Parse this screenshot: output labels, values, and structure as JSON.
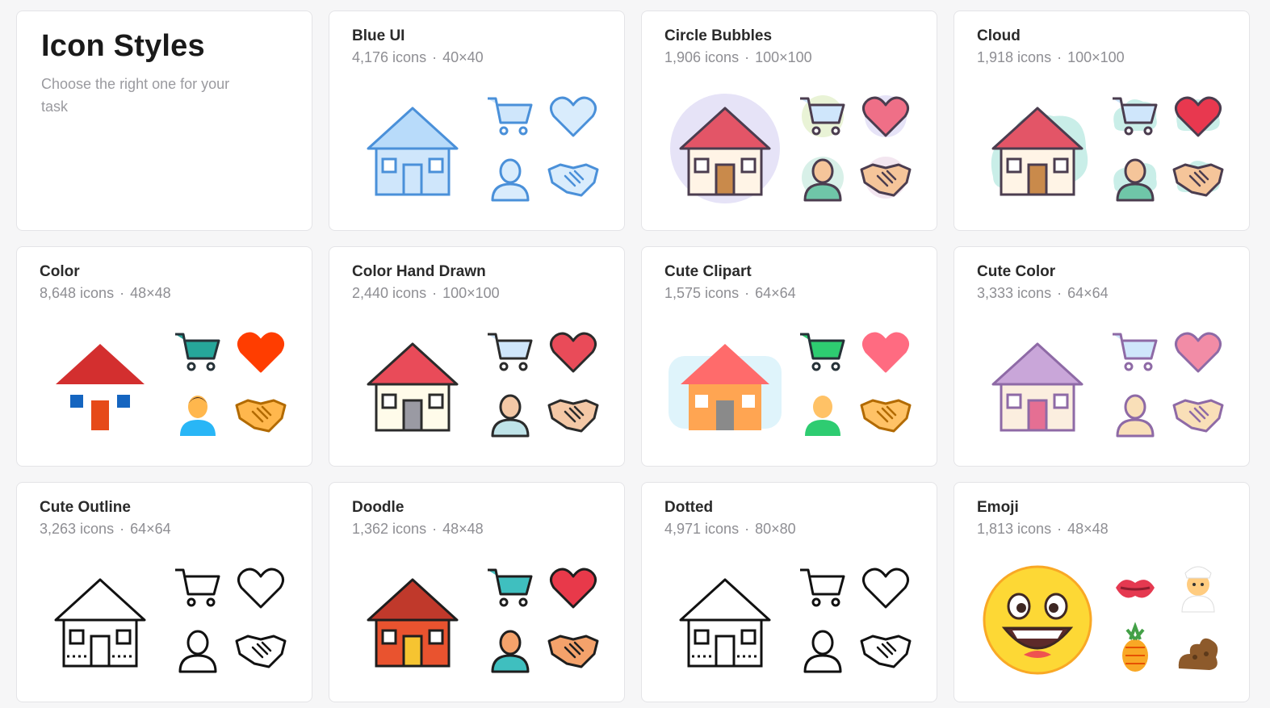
{
  "intro": {
    "title": "Icon Styles",
    "subtitle": "Choose the right one for your task"
  },
  "icon_subjects": [
    "house-icon",
    "shopping-cart-icon",
    "heart-icon",
    "user-icon",
    "handshake-icon"
  ],
  "styles": [
    {
      "key": "blue-ui",
      "title": "Blue UI",
      "count": "4,176 icons",
      "size": "40×40",
      "palette": {
        "stroke": "#4a90d9",
        "fill": "#cfe6fb",
        "roof": "#b8dbfa",
        "door": "#cfe6fb",
        "bg": "none",
        "heart": "#d9ecfc",
        "skin": "#d9ecfc",
        "shirt": "#d9ecfc"
      }
    },
    {
      "key": "circle-bubbles",
      "title": "Circle Bubbles",
      "count": "1,906 icons",
      "size": "100×100",
      "palette": {
        "stroke": "#4b3d4f",
        "fill": "#fff4e6",
        "roof": "#e35567",
        "door": "#c98a4b",
        "bg": "#e6e3f7",
        "heart": "#ef6f87",
        "skin": "#f5c59a",
        "shirt": "#6fc6a8"
      }
    },
    {
      "key": "cloud",
      "title": "Cloud",
      "count": "1,918 icons",
      "size": "100×100",
      "palette": {
        "stroke": "#4b3d4f",
        "fill": "#fff4e6",
        "roof": "#e35567",
        "door": "#c98a4b",
        "bg": "#c9eee8",
        "heart": "#e8384f",
        "skin": "#f5c59a",
        "shirt": "#6fc6a8"
      }
    },
    {
      "key": "color",
      "title": "Color",
      "count": "8,648 icons",
      "size": "48×48",
      "palette": {
        "stroke": "none",
        "fill": "#ffffff",
        "roof": "#d32f2f",
        "door": "#e64a19",
        "bg": "none",
        "heart": "#ff3d00",
        "skin": "#ffb74d",
        "shirt": "#29b6f6"
      }
    },
    {
      "key": "color-hand-drawn",
      "title": "Color Hand Drawn",
      "count": "2,440 icons",
      "size": "100×100",
      "palette": {
        "stroke": "#2b2b2b",
        "fill": "#fffbea",
        "roof": "#e94b59",
        "door": "#9a9aa3",
        "bg": "none",
        "heart": "#e94b59",
        "skin": "#f4c8a6",
        "shirt": "#bfe3e8"
      }
    },
    {
      "key": "cute-clipart",
      "title": "Cute Clipart",
      "count": "1,575 icons",
      "size": "64×64",
      "palette": {
        "stroke": "none",
        "fill": "#ffa552",
        "roof": "#ff6b6b",
        "door": "#8a8a8a",
        "bg": "#dff4fb",
        "heart": "#ff6b81",
        "skin": "#ffc266",
        "shirt": "#2ecc71"
      }
    },
    {
      "key": "cute-color",
      "title": "Cute Color",
      "count": "3,333 icons",
      "size": "64×64",
      "palette": {
        "stroke": "#8e6aa6",
        "fill": "#fbeedf",
        "roof": "#c9a6d9",
        "door": "#e56f93",
        "bg": "none",
        "heart": "#f28ca6",
        "skin": "#f9dfb8",
        "shirt": "#f9dfb8"
      }
    },
    {
      "key": "cute-outline",
      "title": "Cute Outline",
      "count": "3,263 icons",
      "size": "64×64",
      "palette": {
        "stroke": "#111111",
        "fill": "#ffffff",
        "roof": "#ffffff",
        "door": "#ffffff",
        "bg": "none",
        "heart": "#ffffff",
        "skin": "#ffffff",
        "shirt": "#ffffff"
      }
    },
    {
      "key": "doodle",
      "title": "Doodle",
      "count": "1,362 icons",
      "size": "48×48",
      "palette": {
        "stroke": "#1e1e1e",
        "fill": "#e9532f",
        "roof": "#c0392b",
        "door": "#f6c431",
        "bg": "none",
        "heart": "#e8394a",
        "skin": "#f4a26b",
        "shirt": "#3fbfbf"
      }
    },
    {
      "key": "dotted",
      "title": "Dotted",
      "count": "4,971 icons",
      "size": "80×80",
      "palette": {
        "stroke": "#111111",
        "fill": "#ffffff",
        "roof": "#ffffff",
        "door": "#ffffff",
        "bg": "none",
        "heart": "#ffffff",
        "skin": "#ffffff",
        "shirt": "#ffffff"
      }
    },
    {
      "key": "emoji",
      "title": "Emoji",
      "count": "1,813 icons",
      "size": "48×48",
      "palette": {
        "stroke": "none",
        "fill": "#fdd835",
        "roof": "#f9a825",
        "door": "#6d4c41",
        "bg": "none",
        "heart": "#e53950",
        "skin": "#ffcc80",
        "shirt": "#ffffff"
      }
    }
  ]
}
